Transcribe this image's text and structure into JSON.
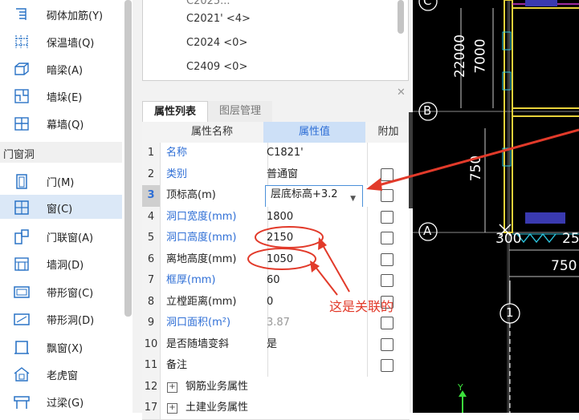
{
  "left_panel": {
    "items_top": [
      {
        "label": "砌体加筋(Y)",
        "icon": "masonry-rebar-icon"
      },
      {
        "label": "保温墙(Q)",
        "icon": "insulation-wall-icon"
      },
      {
        "label": "暗梁(A)",
        "icon": "hidden-beam-icon"
      },
      {
        "label": "墙垛(E)",
        "icon": "wall-pier-icon"
      },
      {
        "label": "幕墙(Q)",
        "icon": "curtain-wall-icon"
      }
    ],
    "category": "门窗洞",
    "items_bottom": [
      {
        "label": "门(M)",
        "icon": "door-icon"
      },
      {
        "label": "窗(C)",
        "icon": "window-icon"
      },
      {
        "label": "门联窗(A)",
        "icon": "door-window-icon"
      },
      {
        "label": "墙洞(D)",
        "icon": "wall-opening-icon"
      },
      {
        "label": "带形窗(C)",
        "icon": "strip-window-icon"
      },
      {
        "label": "带形洞(D)",
        "icon": "strip-opening-icon"
      },
      {
        "label": "飘窗(X)",
        "icon": "bay-window-icon"
      },
      {
        "label": "老虎窗",
        "icon": "dormer-window-icon"
      },
      {
        "label": "过梁(G)",
        "icon": "lintel-icon"
      }
    ],
    "selected": "窗(C)"
  },
  "component_list": [
    "C2021' <4>",
    "C2024 <0>",
    "C2409 <0>"
  ],
  "tabs": [
    "属性列表",
    "图层管理"
  ],
  "property_grid": {
    "headers": {
      "name": "属性名称",
      "value": "属性值",
      "extra": "附加"
    },
    "rows": [
      {
        "num": "1",
        "name": "名称",
        "value": "C1821'",
        "name_blue": true,
        "check": false
      },
      {
        "num": "2",
        "name": "类别",
        "value": "普通窗",
        "name_blue": true,
        "check": true
      },
      {
        "num": "3",
        "name": "顶标高(m)",
        "value": "层底标高+3.2",
        "name_blue": false,
        "check": true,
        "selected": true
      },
      {
        "num": "4",
        "name": "洞口宽度(mm)",
        "value": "1800",
        "name_blue": true,
        "check": true
      },
      {
        "num": "5",
        "name": "洞口高度(mm)",
        "value": "2150",
        "name_blue": true,
        "check": true
      },
      {
        "num": "6",
        "name": "离地高度(mm)",
        "value": "1050",
        "name_blue": false,
        "check": true
      },
      {
        "num": "7",
        "name": "框厚(mm)",
        "value": "60",
        "name_blue": true,
        "check": true
      },
      {
        "num": "8",
        "name": "立樘距离(mm)",
        "value": "0",
        "name_blue": false,
        "check": true
      },
      {
        "num": "9",
        "name": "洞口面积(m²)",
        "value": "3.87",
        "name_blue": true,
        "value_gray": true,
        "check": true
      },
      {
        "num": "10",
        "name": "是否随墙变斜",
        "value": "是",
        "name_blue": false,
        "check": true
      },
      {
        "num": "11",
        "name": "备注",
        "value": "",
        "name_blue": false,
        "check": true
      },
      {
        "num": "12",
        "name": "钢筋业务属性",
        "value": "",
        "group": true
      },
      {
        "num": "17",
        "name": "土建业务属性",
        "value": "",
        "group": true
      }
    ]
  },
  "cad": {
    "axis_labels": [
      "C",
      "B",
      "A",
      "1"
    ],
    "dims": [
      "22000",
      "7000",
      "750",
      "300",
      "25",
      "750"
    ],
    "ucs": "Y"
  },
  "annotation": {
    "text": "这是关联的",
    "color": "#e23a2a"
  }
}
